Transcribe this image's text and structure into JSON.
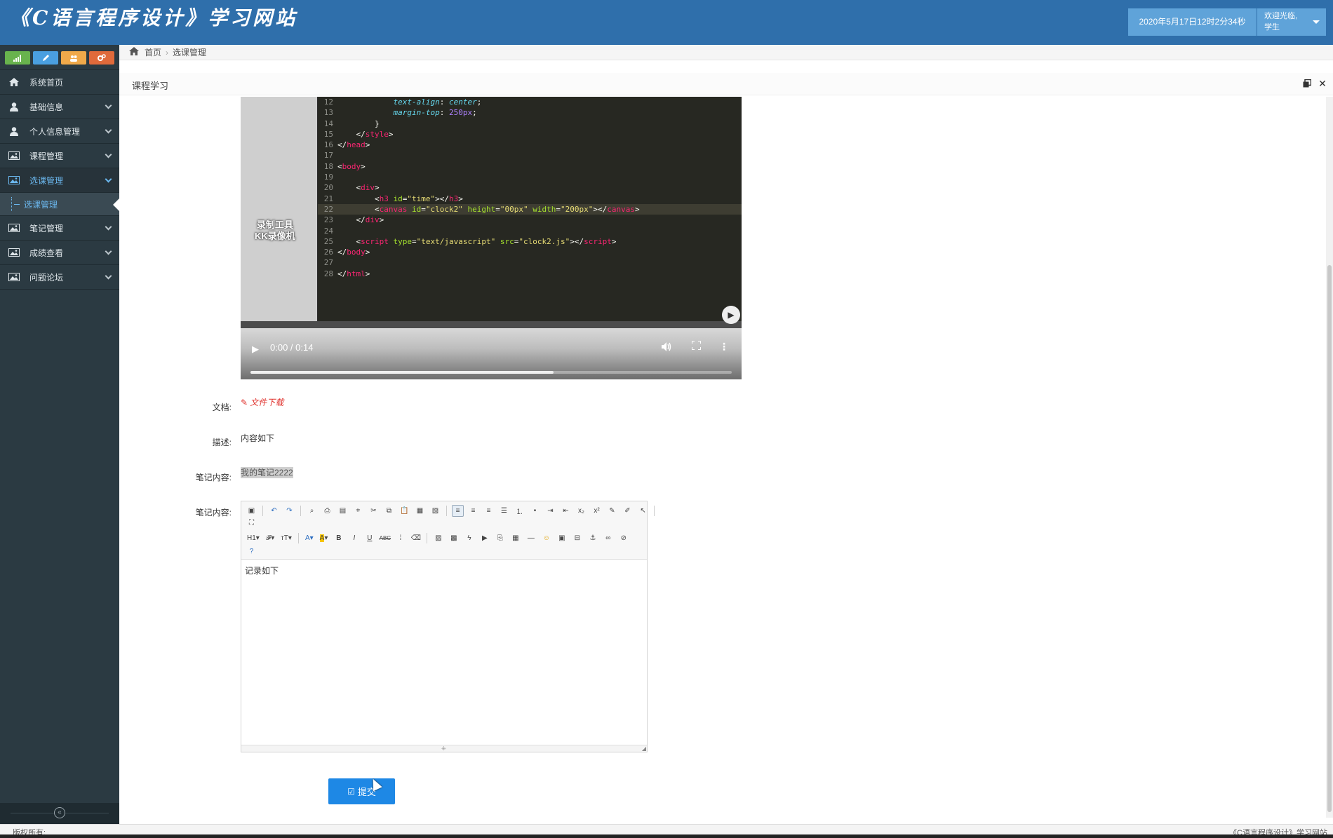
{
  "header": {
    "title": "《C语言程序设计》学习网站",
    "datetime": "2020年5月17日12时2分34秒",
    "welcome": "欢迎光临,",
    "role": "学生"
  },
  "sidebar": {
    "shortcuts": [
      {
        "icon": "signal-icon",
        "color": "#68b34d"
      },
      {
        "icon": "pencil-icon",
        "color": "#4a9fe0"
      },
      {
        "icon": "users-icon",
        "color": "#f0a94a"
      },
      {
        "icon": "cogs-icon",
        "color": "#e06a3b"
      }
    ],
    "items": [
      {
        "label": "系统首页",
        "icon": "home-icon"
      },
      {
        "label": "基础信息",
        "icon": "user-icon"
      },
      {
        "label": "个人信息管理",
        "icon": "user-icon"
      },
      {
        "label": "课程管理",
        "icon": "picture-icon"
      },
      {
        "label": "选课管理",
        "icon": "picture-icon"
      },
      {
        "label": "笔记管理",
        "icon": "picture-icon"
      },
      {
        "label": "成绩查看",
        "icon": "picture-icon"
      },
      {
        "label": "问题论坛",
        "icon": "picture-icon"
      }
    ],
    "active_sub_item": "选课管理"
  },
  "breadcrumb": {
    "home": "首页",
    "current": "选课管理"
  },
  "panel": {
    "title": "课程学习"
  },
  "video": {
    "time": "0:00 / 0:14",
    "progress": 0.63,
    "watermark_line1": "录制工具",
    "watermark_line2": "KK录像机",
    "code_lines": [
      {
        "n": "12",
        "html": "            <span class='k-prop'>text-align</span>: <span class='k-prop'>center</span>;"
      },
      {
        "n": "13",
        "html": "            <span class='k-prop'>margin-top</span>: <span class='k-num'>250px</span>;"
      },
      {
        "n": "14",
        "html": "        }"
      },
      {
        "n": "15",
        "html": "    &lt;/<span class='k-tag'>style</span>&gt;"
      },
      {
        "n": "16",
        "html": "&lt;/<span class='k-tag'>head</span>&gt;"
      },
      {
        "n": "17",
        "html": ""
      },
      {
        "n": "18",
        "html": "&lt;<span class='k-tag'>body</span>&gt;"
      },
      {
        "n": "19",
        "html": ""
      },
      {
        "n": "20",
        "html": "    &lt;<span class='k-tag'>div</span>&gt;"
      },
      {
        "n": "21",
        "html": "        &lt;<span class='k-tag'>h3</span> <span class='k-attr'>id</span>=<span class='k-str'>\"time\"</span>&gt;&lt;/<span class='k-tag'>h3</span>&gt;"
      },
      {
        "n": "22",
        "html": "        &lt;<span class='k-tag'>canvas</span> <span class='k-attr'>id</span>=<span class='k-str'>\"clock2\"</span> <span class='k-attr'>height</span>=<span class='k-str'>\"00px\"</span> <span class='k-attr'>width</span>=<span class='k-str'>\"200px\"</span>&gt;&lt;/<span class='k-tag'>canvas</span>&gt;"
      },
      {
        "n": "23",
        "html": "    &lt;/<span class='k-tag'>div</span>&gt;"
      },
      {
        "n": "24",
        "html": ""
      },
      {
        "n": "25",
        "html": "    &lt;<span class='k-tag'>script</span> <span class='k-attr'>type</span>=<span class='k-str'>\"text/javascript\"</span> <span class='k-attr'>src</span>=<span class='k-str'>\"clock2.js\"</span>&gt;&lt;/<span class='k-tag'>script</span>&gt;"
      },
      {
        "n": "26",
        "html": "&lt;/<span class='k-tag'>body</span>&gt;"
      },
      {
        "n": "27",
        "html": ""
      },
      {
        "n": "28",
        "html": "&lt;/<span class='k-tag'>html</span>&gt;"
      }
    ]
  },
  "form": {
    "doc_label": "文档:",
    "doc_link": "文件下载",
    "desc_label": "描述:",
    "desc_value": "内容如下",
    "note_label": "笔记内容:",
    "note_value": "我的笔记2222",
    "editor_label": "笔记内容:",
    "editor_content": "记录如下",
    "submit_label": "提交"
  },
  "footer": {
    "left": "版权所有:",
    "right": "《C语言程序设计》学习网站"
  }
}
